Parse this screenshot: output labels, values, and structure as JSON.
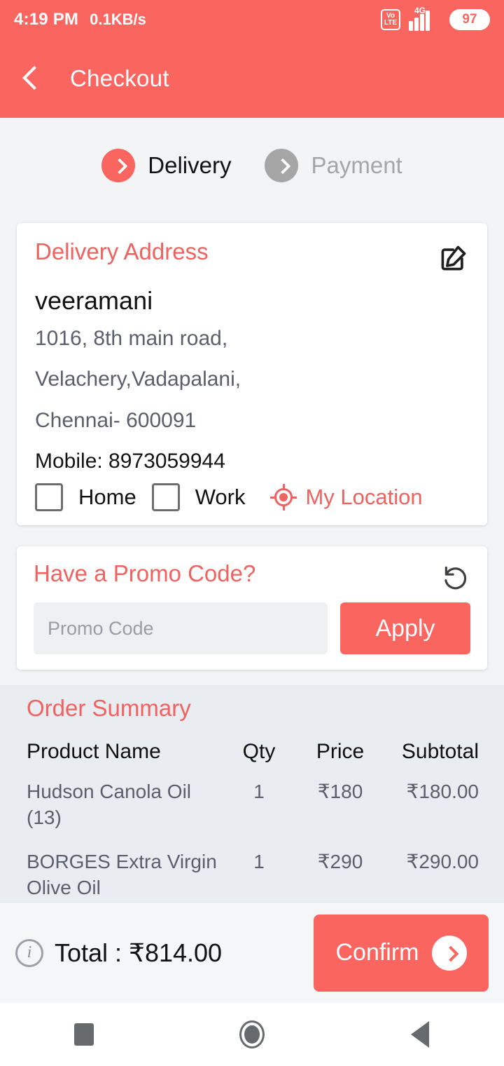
{
  "status_bar": {
    "time": "4:19 PM",
    "network_speed": "0.1KB/s",
    "volte_top": "Vo",
    "volte_bottom": "LTE",
    "signal_label": "4G",
    "battery": "97"
  },
  "app_bar": {
    "back_icon": "back-chevron-icon",
    "title": "Checkout"
  },
  "stepper": {
    "steps": [
      {
        "label": "Delivery",
        "state": "active"
      },
      {
        "label": "Payment",
        "state": "inactive"
      }
    ]
  },
  "address_card": {
    "title": "Delivery Address",
    "edit_icon": "edit-icon",
    "name": "veeramani",
    "lines": [
      "1016, 8th main road,",
      "Velachery,Vadapalani,",
      "Chennai- 600091"
    ],
    "mobile": "Mobile: 8973059944",
    "tags": [
      {
        "label": "Home",
        "checked": false
      },
      {
        "label": "Work",
        "checked": false
      }
    ],
    "my_location": "My Location"
  },
  "promo_card": {
    "title": "Have a Promo Code?",
    "reset_icon": "refresh-icon",
    "input_value": "",
    "input_placeholder": "Promo Code",
    "apply_label": "Apply"
  },
  "order_summary": {
    "title": "Order Summary",
    "columns": [
      "Product Name",
      "Qty",
      "Price",
      "Subtotal"
    ],
    "rows": [
      {
        "name": "Hudson Canola Oil (13)",
        "qty": "1",
        "price": "₹180",
        "subtotal": "₹180.00"
      },
      {
        "name": "BORGES Extra Virgin Olive Oil",
        "qty": "1",
        "price": "₹290",
        "subtotal": "₹290.00"
      }
    ]
  },
  "bottom_bar": {
    "info_icon": "info-icon",
    "info_glyph": "i",
    "total_label": "Total : ₹814.00",
    "confirm_label": "Confirm"
  },
  "nav_bar": {
    "recents": "square-icon",
    "home": "circle-icon",
    "back": "triangle-left-icon"
  },
  "colors": {
    "brand_red": "#fb6560",
    "title_red": "#f0625f",
    "page_bg": "#f2f4f6",
    "summary_bg": "#e9ecf0",
    "body_gray": "#5b5f6b",
    "inactive_gray": "#a6a6a6"
  }
}
